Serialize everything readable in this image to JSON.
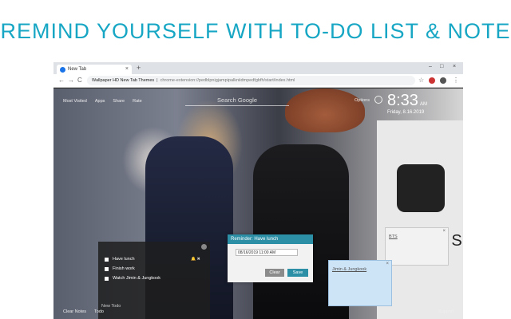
{
  "headline": "REMIND YOURSELF WITH TO-DO LIST & NOTE",
  "browser": {
    "tab_title": "New Tab",
    "new_tab": "+",
    "tab_close": "×",
    "window_controls": [
      "–",
      "□",
      "×"
    ],
    "nav": [
      "←",
      "→",
      "C"
    ],
    "page_title": "Wallpaper HD New Tab Themes",
    "url": "chrome-extension://pedblpnigjampipalkniidmpedfgbfh/start/index.html",
    "star": "☆"
  },
  "newtab": {
    "top_links": [
      "Most Visited",
      "Apps",
      "Share",
      "Rate"
    ],
    "search_placeholder": "Search Google",
    "options_label": "Options",
    "clock_time": "8:33",
    "clock_suffix": "AM",
    "clock_date": "Friday, 8.16.2019",
    "poster_text": "WINGS",
    "bottom_left": [
      "Clear Notes",
      "Todo"
    ],
    "bottom_right": "Support"
  },
  "todo": {
    "items": [
      {
        "label": "Have lunch"
      },
      {
        "label": "Finish work"
      },
      {
        "label": "Watch Jimin & Jungkook"
      }
    ],
    "new_todo_label": "New Todo"
  },
  "reminder": {
    "title": "Reminder: Have lunch",
    "datetime": "08/16/2019 11:00 AM",
    "clear_label": "Clear",
    "save_label": "Save"
  },
  "notes": [
    {
      "text": "Jimin & Jungkook"
    },
    {
      "text": "BTS"
    }
  ],
  "colors": {
    "accent": "#17a7c4",
    "reminder_header": "#2c8fa6",
    "note_blue": "#cde3f6"
  }
}
